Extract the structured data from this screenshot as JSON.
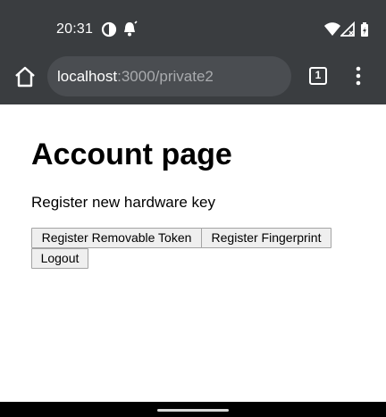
{
  "status_bar": {
    "time": "20:31",
    "left_icons": [
      "data-saver-icon",
      "notification-icon"
    ],
    "right_icons": [
      "wifi-icon",
      "cell-signal-icon",
      "battery-icon"
    ]
  },
  "browser": {
    "url_host": "localhost",
    "url_path": ":3000/private2",
    "tab_count": "1",
    "icons": {
      "home": "home-icon",
      "menu": "more-vertical-icon"
    }
  },
  "page": {
    "title": "Account page",
    "section_text": "Register new hardware key",
    "buttons": {
      "register_removable": "Register Removable Token",
      "register_fingerprint": "Register Fingerprint",
      "logout": "Logout"
    }
  },
  "colors": {
    "chrome_bg": "#3a3d40",
    "url_pill_bg": "#4a4d51",
    "url_path": "#a9abae",
    "button_bg": "#efefef",
    "button_border": "#a4a4a4"
  }
}
